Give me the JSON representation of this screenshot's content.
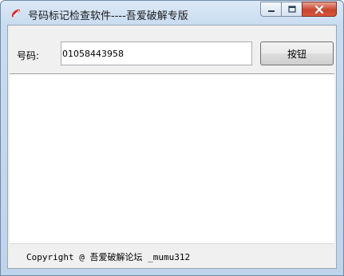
{
  "window": {
    "title": "号码标记检查软件----吾爱破解专版"
  },
  "form": {
    "number_label": "号码:",
    "number_value": "01058443958",
    "button_label": "按钮"
  },
  "footer": {
    "copyright": "Copyright @ 吾爱破解论坛 _mumu312"
  },
  "icons": {
    "app": "pen-logo-icon",
    "minimize": "minimize-icon",
    "maximize": "maximize-icon",
    "close": "close-icon"
  },
  "colors": {
    "app_icon": "#e0282e",
    "close_button": "#c8452f"
  }
}
